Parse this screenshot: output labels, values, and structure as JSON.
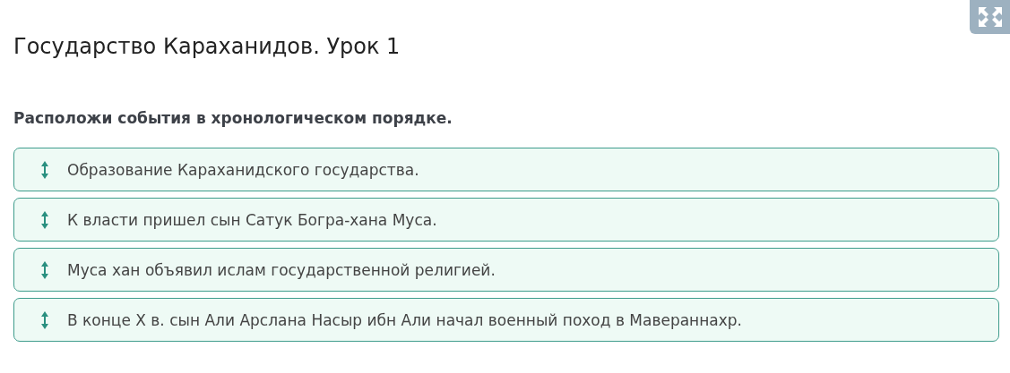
{
  "title": "Государство Караханидов. Урок 1",
  "question": "Расположи события в хронологическом порядке.",
  "items": [
    {
      "text": "Образование Караханидского государства."
    },
    {
      "text": "К власти пришел сын Сатук Богра-хана Муса."
    },
    {
      "text": "Муса хан объявил ислам государственной религией."
    },
    {
      "text": "В конце X в. сын Али Арслана Насыр ибн Али начал военный поход в Мавераннахр."
    }
  ]
}
